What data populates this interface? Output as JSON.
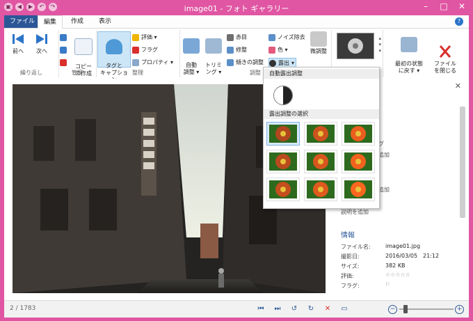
{
  "window": {
    "title": "image01 - フォト ギャラリー",
    "controls": {
      "minimize": "–",
      "maximize": "□",
      "close": "✕"
    }
  },
  "tabs": [
    {
      "label": "ファイル"
    },
    {
      "label": "編集"
    },
    {
      "label": "作成"
    },
    {
      "label": "表示"
    }
  ],
  "help_icon": "?",
  "ribbon": {
    "groups": [
      {
        "label": "繰り返し"
      },
      {
        "label": "管理"
      },
      {
        "label": "整理"
      },
      {
        "label": "調整"
      }
    ],
    "prev": "前へ",
    "next": "次へ",
    "copy": "コピー\nの作成",
    "tag_caption": "タグと\nキャプション",
    "rating": "評価 ▾",
    "flag": "フラグ",
    "property": "プロパティ ▾",
    "auto_adjust": "自動\n調整 ▾",
    "trimming": "トリミ\nング ▾",
    "redeye": "赤目",
    "retouch": "修整",
    "straighten": "傾きの調整",
    "noise": "ノイズ除去",
    "color": "色 ▾",
    "exposure": "露出",
    "fine_tune": "微調整",
    "revert": "最初の状態\nに戻す ▾",
    "close_file": "ファイル\nを閉じる"
  },
  "dropdown": {
    "auto_title": "自動露出調整",
    "select_title": "露出調整の選択",
    "thumbs_count": 9
  },
  "info": {
    "title": "情報",
    "filename_label": "ファイル名:",
    "filename": "image01.jpg",
    "date_label": "撮影日:",
    "date": "2016/03/05",
    "time": "21:12",
    "size_label": "サイズ:",
    "size": "382 KB",
    "rating_label": "評価:",
    "rating_stars": "☆☆☆☆☆",
    "flag_label": "フラグ:",
    "flag_icon": "⚐",
    "partial": [
      "グ",
      "追加",
      "追加",
      "説明を追加"
    ]
  },
  "status": {
    "count": "2 / 1783"
  }
}
